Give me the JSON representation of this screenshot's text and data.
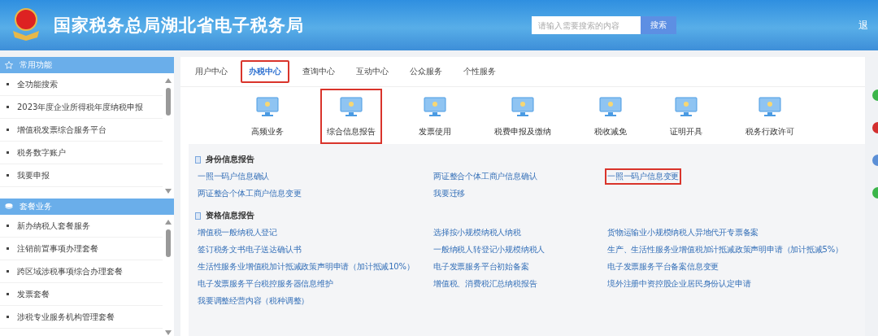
{
  "header": {
    "title": "国家税务总局湖北省电子税务局",
    "search": {
      "placeholder": "请输入需要搜索的内容",
      "button": "搜索"
    },
    "logout": "退"
  },
  "sidebar": {
    "groups": [
      {
        "title": "常用功能",
        "kind": "star",
        "items": [
          "全功能搜索",
          "2023年度企业所得税年度纳税申报",
          "增值税发票综合服务平台",
          "税务数字账户",
          "我要申报"
        ]
      },
      {
        "title": "套餐业务",
        "kind": "stack",
        "items": [
          "新办纳税人套餐服务",
          "注销前置事项办理套餐",
          "跨区域涉税事项综合办理套餐",
          "发票套餐",
          "涉税专业服务机构管理套餐"
        ]
      }
    ]
  },
  "tabs": [
    {
      "label": "用户中心",
      "selected": false,
      "highlighted": false
    },
    {
      "label": "办税中心",
      "selected": true,
      "highlighted": true
    },
    {
      "label": "查询中心",
      "selected": false,
      "highlighted": false
    },
    {
      "label": "互动中心",
      "selected": false,
      "highlighted": false
    },
    {
      "label": "公众服务",
      "selected": false,
      "highlighted": false
    },
    {
      "label": "个性服务",
      "selected": false,
      "highlighted": false
    }
  ],
  "services": [
    {
      "label": "高频业务",
      "highlighted": false
    },
    {
      "label": "综合信息报告",
      "highlighted": true
    },
    {
      "label": "发票使用",
      "highlighted": false
    },
    {
      "label": "税费申报及缴纳",
      "highlighted": false
    },
    {
      "label": "税收减免",
      "highlighted": false
    },
    {
      "label": "证明开具",
      "highlighted": false
    },
    {
      "label": "税务行政许可",
      "highlighted": false
    }
  ],
  "sections": [
    {
      "title": "身份信息报告",
      "links": [
        {
          "label": "一照一码户信息确认",
          "highlighted": false
        },
        {
          "label": "两证整合个体工商户信息确认",
          "highlighted": false
        },
        {
          "label": "一照一码户信息变更",
          "highlighted": true
        },
        {
          "label": "两证整合个体工商户信息变更",
          "highlighted": false
        },
        {
          "label": "我要迁移",
          "highlighted": false
        }
      ]
    },
    {
      "title": "资格信息报告",
      "links": [
        {
          "label": "增值税一般纳税人登记",
          "highlighted": false
        },
        {
          "label": "选择按小规模纳税人纳税",
          "highlighted": false
        },
        {
          "label": "货物运输业小规模纳税人异地代开专票备案",
          "highlighted": false
        },
        {
          "label": "签订税务文书电子送达确认书",
          "highlighted": false
        },
        {
          "label": "一般纳税人转登记小规模纳税人",
          "highlighted": false
        },
        {
          "label": "生产、生活性服务业增值税加计抵减政策声明申请（加计抵减5%）",
          "highlighted": false
        },
        {
          "label": "生活性服务业增值税加计抵减政策声明申请（加计抵减10%）",
          "highlighted": false
        },
        {
          "label": "电子发票服务平台初始备案",
          "highlighted": false
        },
        {
          "label": "电子发票服务平台备案信息变更",
          "highlighted": false
        },
        {
          "label": "电子发票服务平台税控服务器信息维护",
          "highlighted": false
        },
        {
          "label": "增值税、消费税汇总纳税报告",
          "highlighted": false
        },
        {
          "label": "境外注册中资控股企业居民身份认定申请",
          "highlighted": false
        },
        {
          "label": "我要调整经营内容（税种调整）",
          "highlighted": false
        }
      ]
    }
  ]
}
